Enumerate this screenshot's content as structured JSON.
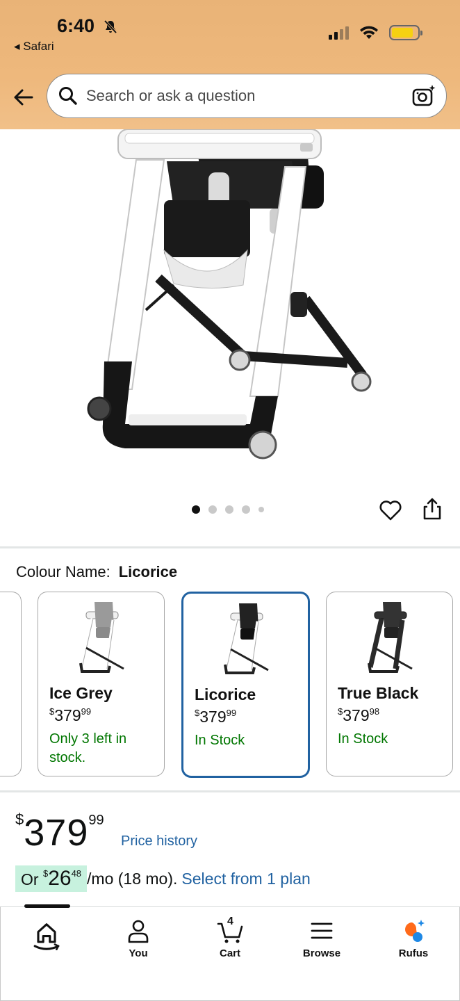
{
  "status_bar": {
    "time": "6:40",
    "back_app": "◂ Safari"
  },
  "search": {
    "placeholder": "Search or ask a question"
  },
  "gallery": {
    "dot_count": 5,
    "active_index": 0
  },
  "colour": {
    "label": "Colour Name:",
    "selected": "Licorice"
  },
  "swatches": [
    {
      "name": "Ice Grey",
      "currency": "$",
      "whole": "379",
      "fraction": "99",
      "stock": "Only 3 left in stock.",
      "selected": false
    },
    {
      "name": "Licorice",
      "currency": "$",
      "whole": "379",
      "fraction": "99",
      "stock": "In Stock",
      "selected": true
    },
    {
      "name": "True Black",
      "currency": "$",
      "whole": "379",
      "fraction": "98",
      "stock": "In Stock",
      "selected": false
    }
  ],
  "price": {
    "currency": "$",
    "whole": "379",
    "fraction": "99",
    "history_link": "Price history"
  },
  "installment": {
    "prefix": "Or",
    "currency": "$",
    "amount": "26",
    "fraction": "48",
    "suffix": "/mo (18 mo).",
    "link": "Select from 1 plan"
  },
  "bottom_nav": {
    "you": "You",
    "cart": "Cart",
    "cart_count": "4",
    "browse": "Browse",
    "rufus": "Rufus"
  },
  "colors": {
    "header_bg": "#eeb87c",
    "link": "#2162a1",
    "in_stock": "#007600",
    "selected_border": "#2162a1",
    "installment_highlight": "#c7f1de",
    "rufus_orange": "#ff6a1a",
    "rufus_blue": "#1e88e5"
  }
}
